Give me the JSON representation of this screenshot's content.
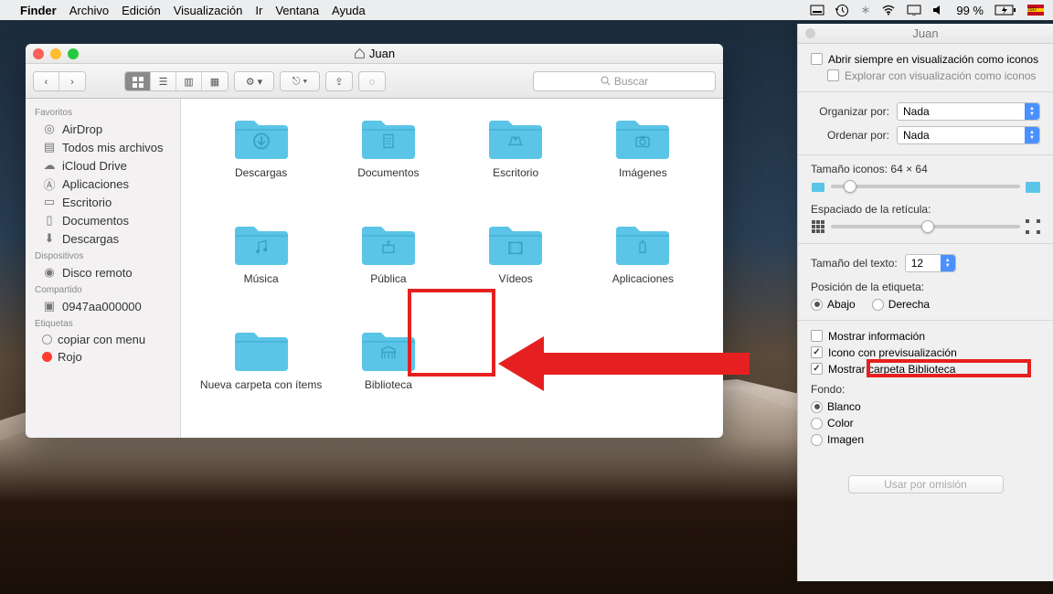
{
  "menubar": {
    "app": "Finder",
    "items": [
      "Archivo",
      "Edición",
      "Visualización",
      "Ir",
      "Ventana",
      "Ayuda"
    ],
    "battery": "99 %"
  },
  "finder": {
    "title": "Juan",
    "search_placeholder": "Buscar",
    "sidebar": {
      "favorites_header": "Favoritos",
      "favorites": [
        "AirDrop",
        "Todos mis archivos",
        "iCloud Drive",
        "Aplicaciones",
        "Escritorio",
        "Documentos",
        "Descargas"
      ],
      "devices_header": "Dispositivos",
      "devices": [
        "Disco remoto"
      ],
      "shared_header": "Compartido",
      "shared": [
        "0947aa000000"
      ],
      "tags_header": "Etiquetas",
      "tags": [
        "copiar con menu",
        "Rojo"
      ]
    },
    "folders": [
      {
        "name": "Descargas",
        "glyph": "download"
      },
      {
        "name": "Documentos",
        "glyph": "doc"
      },
      {
        "name": "Escritorio",
        "glyph": "desk"
      },
      {
        "name": "Imágenes",
        "glyph": "camera"
      },
      {
        "name": "Música",
        "glyph": "music"
      },
      {
        "name": "Pública",
        "glyph": "public"
      },
      {
        "name": "Vídeos",
        "glyph": "video"
      },
      {
        "name": "Aplicaciones",
        "glyph": "app"
      },
      {
        "name": "Nueva carpeta con ítems",
        "glyph": ""
      },
      {
        "name": "Biblioteca",
        "glyph": "library"
      }
    ]
  },
  "inspector": {
    "title": "Juan",
    "always_icons": "Abrir siempre en visualización como iconos",
    "explore_icons": "Explorar con visualización como iconos",
    "organize_label": "Organizar por:",
    "organize_value": "Nada",
    "sort_label": "Ordenar por:",
    "sort_value": "Nada",
    "icon_size_label": "Tamaño iconos:",
    "icon_size_value": "64 × 64",
    "grid_spacing_label": "Espaciado de la retícula:",
    "text_size_label": "Tamaño del texto:",
    "text_size_value": "12",
    "label_pos_label": "Posición de la etiqueta:",
    "label_pos_below": "Abajo",
    "label_pos_right": "Derecha",
    "show_info": "Mostrar información",
    "show_preview": "Icono con previsualización",
    "show_library": "Mostrar carpeta Biblioteca",
    "background_label": "Fondo:",
    "bg_white": "Blanco",
    "bg_color": "Color",
    "bg_image": "Imagen",
    "default_btn": "Usar por omisión"
  }
}
